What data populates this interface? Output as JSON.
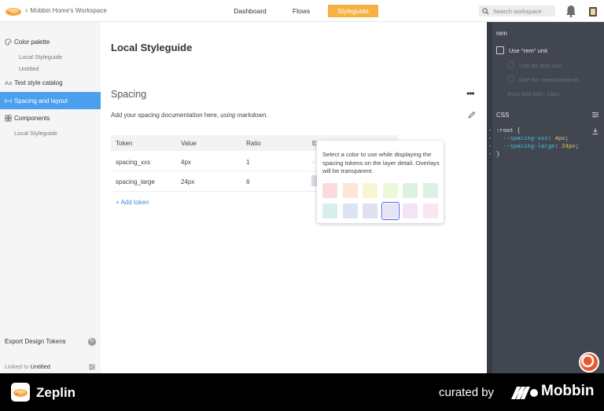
{
  "topbar": {
    "back_label": "Mobbin Home's Workspace",
    "tabs": [
      {
        "label": "Dashboard",
        "active": false
      },
      {
        "label": "Flows",
        "active": false
      },
      {
        "label": "Styleguide",
        "active": true
      }
    ],
    "search_placeholder": "Search workspace",
    "accent_color": "#f6b143"
  },
  "sidebar": {
    "color_palette": "Color palette",
    "color_palette_items": [
      "Local Styleguide",
      "Untitled"
    ],
    "text_style_catalog": "Text style catalog",
    "spacing_and_layout": "Spacing and layout",
    "components": "Components",
    "components_items": [
      "Local Styleguide"
    ],
    "export": "Export Design Tokens",
    "linked_prefix": "Linked to",
    "linked_name": "Untitled",
    "active_color": "#4aa0ef"
  },
  "main": {
    "page_title": "Local Styleguide",
    "section_title": "Spacing",
    "doc_prefix": "Add your spacing documentation here,",
    "doc_italic": "using markdown",
    "doc_suffix": ".",
    "table": {
      "headers": [
        "Token",
        "Value",
        "Ratio",
        "Ex"
      ],
      "rows": [
        {
          "token": "spacing_xxs",
          "value": "4px",
          "ratio": "1",
          "example": "-"
        },
        {
          "token": "spacing_large",
          "value": "24px",
          "ratio": "6",
          "example": ""
        }
      ]
    },
    "add_token": "+ Add token"
  },
  "popover": {
    "text": "Select a color to use while displaying the spacing tokens on the layer detail. Overlays will be transparent.",
    "colors": [
      "#fadcdc",
      "#fde6d6",
      "#f8f6d2",
      "#ecf8d8",
      "#ddf2de",
      "#dbf1e2",
      "#daeeee",
      "#dbe4f5",
      "#e1e0f0",
      "#e9e3f6",
      "#f3e3f5",
      "#fae6f0"
    ],
    "selected_index": 9
  },
  "right_panel": {
    "rem_title": "rem",
    "use_rem_label": "Use \"rem\" unit",
    "font_size_label": "Use for font size",
    "measurements_label": "Use for measurements",
    "root_font_size_label": "Root font size:",
    "root_font_size_value": "16px",
    "css_title": "CSS",
    "code_open": ":root {",
    "code_line1_prop": "--spacing-xxs",
    "code_line1_val": "4px",
    "code_line2_prop": "--spacing-large",
    "code_line2_val": "24px",
    "code_close": "}",
    "bg_color": "#414650"
  },
  "footer": {
    "brand": "Zeplin",
    "curated": "curated by",
    "mobbin": "Mobbin"
  }
}
